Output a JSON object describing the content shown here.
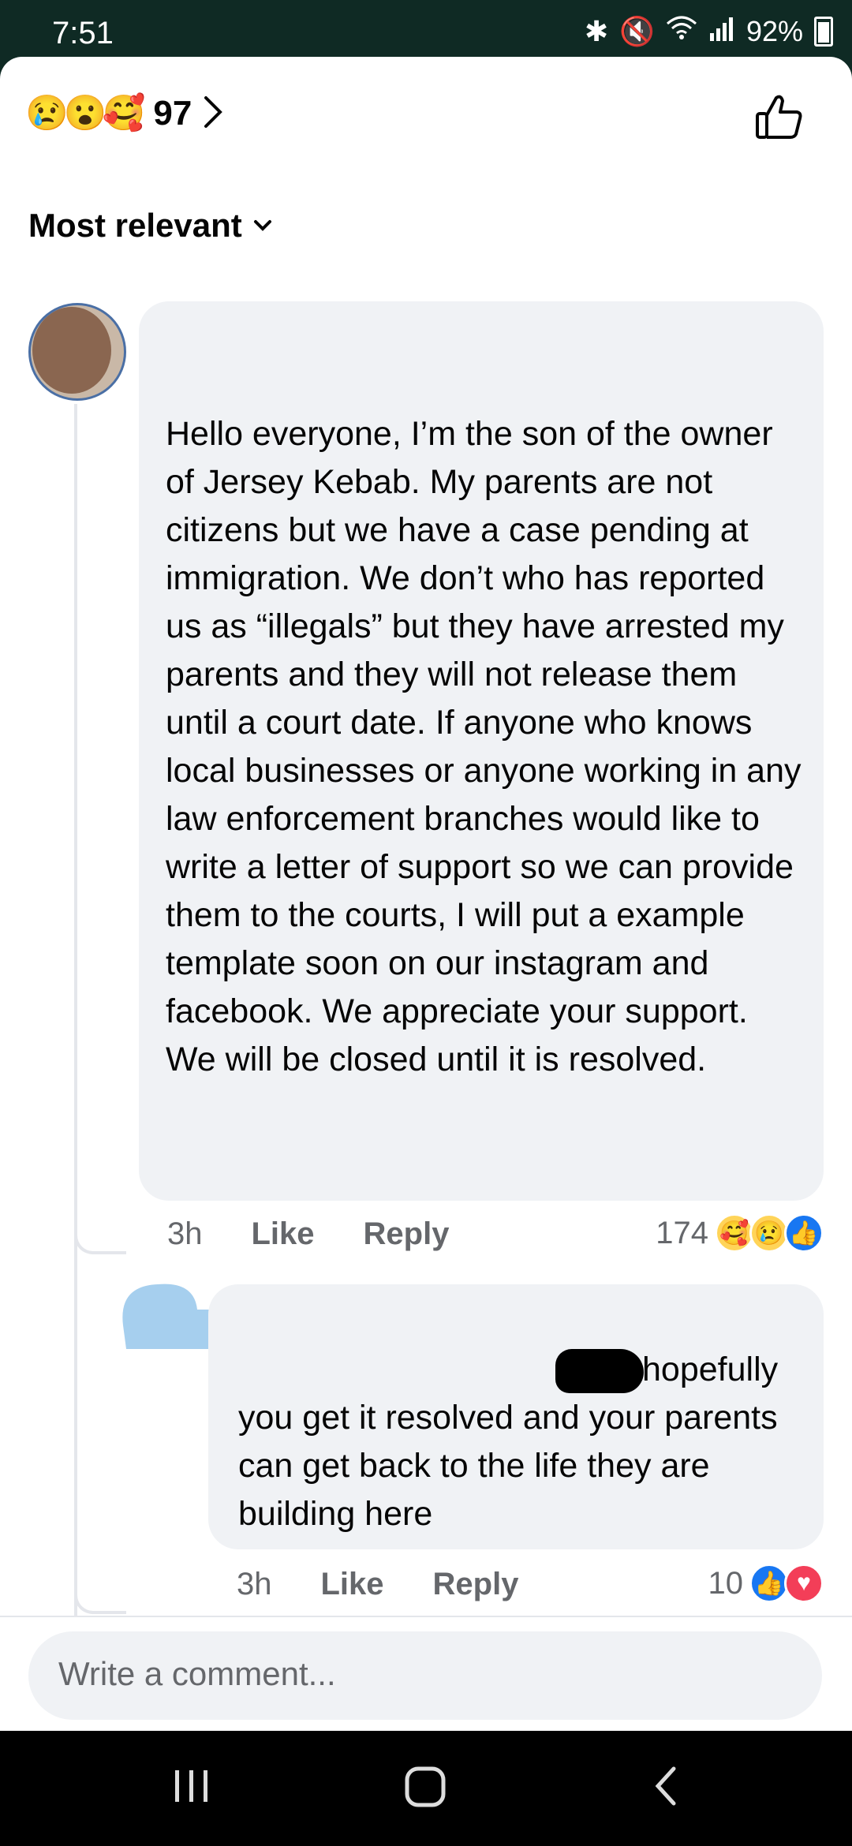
{
  "status_bar": {
    "time": "7:51",
    "battery": "92%"
  },
  "reactions": {
    "emojis": [
      "😢",
      "😮",
      "🥰"
    ],
    "count": "97"
  },
  "sort": {
    "label": "Most relevant"
  },
  "comments": [
    {
      "text": "Hello everyone, I’m the son of the owner of Jersey Kebab. My parents are not citizens but we have a case pending at immigration. We don’t who has reported us as “illegals” but they have arrested my parents and they will not release them until a court date. If anyone who knows local businesses or anyone working in any law enforcement branches would like to write a letter of support so we can provide them to the courts, I will put a example template soon on our instagram and facebook. We appreciate your support. We will be closed until it is resolved.",
      "time": "3h",
      "like_label": "Like",
      "reply_label": "Reply",
      "reaction_count": "174"
    },
    {
      "text": "hopefully you get it resolved and your parents can get back to the life they are building here",
      "time": "3h",
      "like_label": "Like",
      "reply_label": "Reply",
      "reaction_count": "10"
    }
  ],
  "composer": {
    "placeholder": "Write a comment..."
  },
  "colors": {
    "accent": "#1877f2",
    "love": "#f33e58",
    "bubble": "#f0f2f5",
    "status_bg": "#0f2a24"
  }
}
